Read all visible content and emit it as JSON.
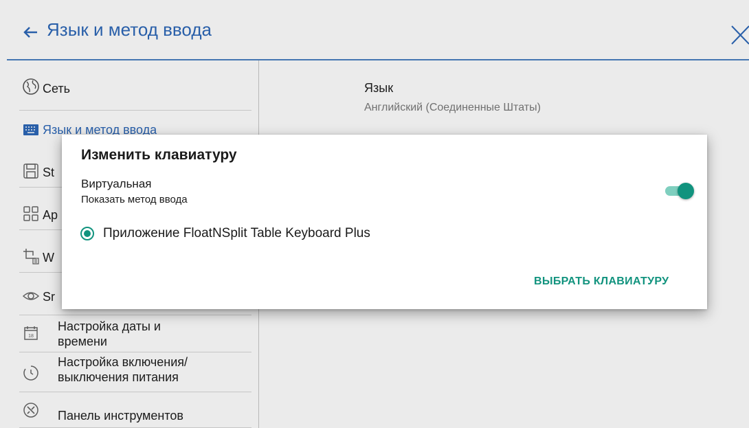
{
  "header": {
    "title": "Язык и метод ввода",
    "back_icon": "arrow-left-icon",
    "close_icon": "close-icon"
  },
  "sidebar": {
    "items": [
      {
        "label": "Сеть",
        "icon": "globe-icon"
      },
      {
        "label": "Язык и метод ввода",
        "icon": "keyboard-icon",
        "active": true
      },
      {
        "label": "St",
        "icon": "storage-icon"
      },
      {
        "label": "Ap",
        "icon": "apps-grid-icon"
      },
      {
        "label": "W",
        "icon": "crop-icon"
      },
      {
        "label": "Sr",
        "icon": "eye-icon"
      },
      {
        "label_line1": "Настройка даты и",
        "label_line2": "времени",
        "icon": "calendar-icon"
      },
      {
        "label_line1": "Настройка включения/",
        "label_line2": "выключения питания",
        "icon": "timer-icon"
      },
      {
        "label": "Панель инструментов",
        "icon": "tools-icon"
      }
    ]
  },
  "content": {
    "language_title": "Язык",
    "language_value": "Английский (Соединенные Штаты)"
  },
  "dialog": {
    "title": "Изменить клавиатуру",
    "virtual_label": "Виртуальная",
    "virtual_sublabel": "Показать метод ввода",
    "toggle_on": true,
    "keyboard_option": "Приложение FloatNSplit Table Keyboard Plus",
    "keyboard_selected": true,
    "choose_button": "ВЫБРАТЬ КЛАВИАТУРУ"
  },
  "colors": {
    "accent_blue": "#2d68b8",
    "accent_teal": "#11937e"
  }
}
